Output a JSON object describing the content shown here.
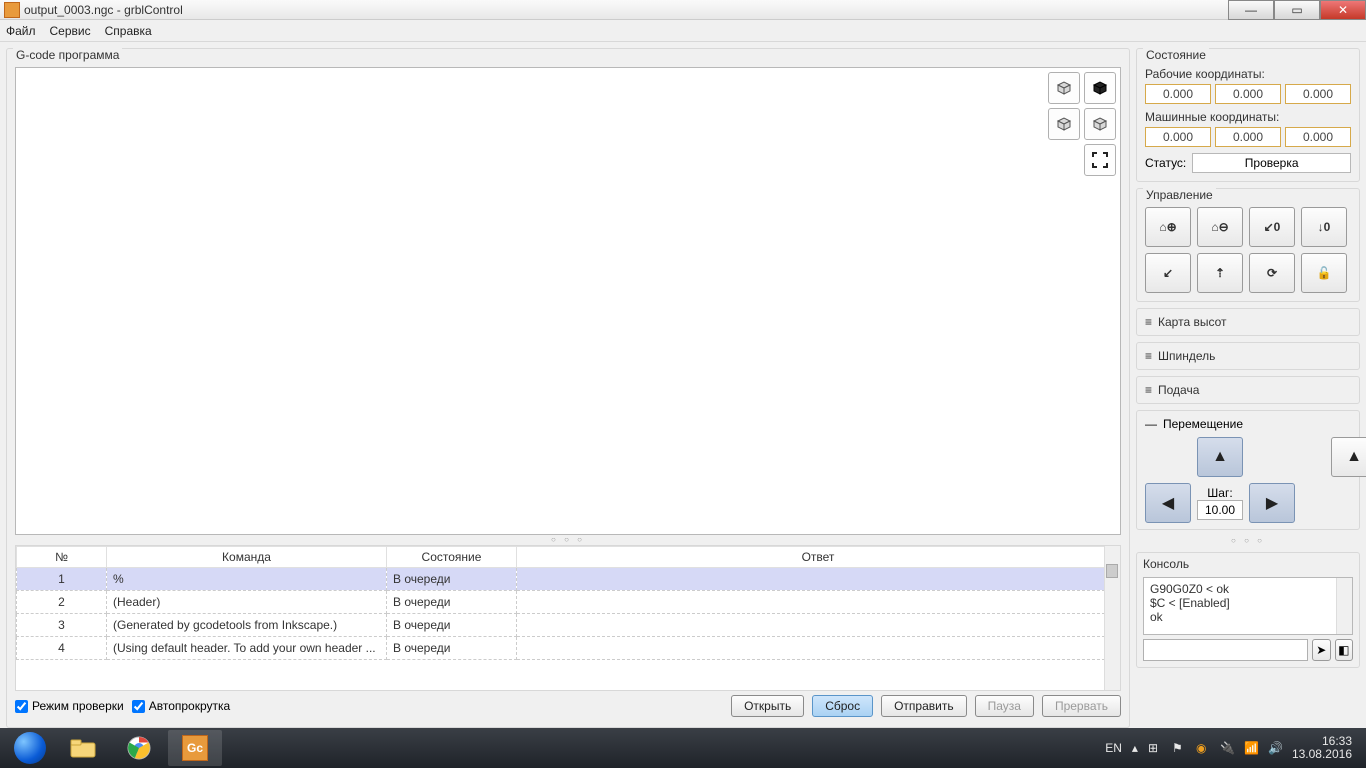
{
  "window": {
    "title": "output_0003.ngc - grblControl"
  },
  "menu": {
    "file": "Файл",
    "service": "Сервис",
    "help": "Справка"
  },
  "gcode": {
    "legend": "G-code программа",
    "columns": {
      "no": "№",
      "cmd": "Команда",
      "state": "Состояние",
      "resp": "Ответ"
    },
    "rows": [
      {
        "no": "1",
        "cmd": "%",
        "state": "В очереди",
        "resp": ""
      },
      {
        "no": "2",
        "cmd": "(Header)",
        "state": "В очереди",
        "resp": ""
      },
      {
        "no": "3",
        "cmd": "(Generated by gcodetools from Inkscape.)",
        "state": "В очереди",
        "resp": ""
      },
      {
        "no": "4",
        "cmd": "(Using default header. To add your own header ...",
        "state": "В очереди",
        "resp": ""
      }
    ],
    "check_mode": "Режим проверки",
    "autoscroll": "Автопрокрутка",
    "buttons": {
      "open": "Открыть",
      "reset": "Сброс",
      "send": "Отправить",
      "pause": "Пауза",
      "abort": "Прервать"
    }
  },
  "state": {
    "legend": "Состояние",
    "work_label": "Рабочие координаты:",
    "work": [
      "0.000",
      "0.000",
      "0.000"
    ],
    "machine_label": "Машинные координаты:",
    "machine": [
      "0.000",
      "0.000",
      "0.000"
    ],
    "status_label": "Статус:",
    "status_value": "Проверка"
  },
  "control": {
    "legend": "Управление"
  },
  "sections": {
    "heightmap": "Карта высот",
    "spindle": "Шпиндель",
    "feed": "Подача"
  },
  "jog": {
    "legend": "Перемещение",
    "step_label": "Шаг:",
    "step_value": "10.00"
  },
  "console": {
    "legend": "Консоль",
    "lines": [
      "G90G0Z0 < ok",
      "$C < [Enabled]",
      "ok"
    ]
  },
  "taskbar": {
    "lang": "EN",
    "time": "16:33",
    "date": "13.08.2016"
  }
}
